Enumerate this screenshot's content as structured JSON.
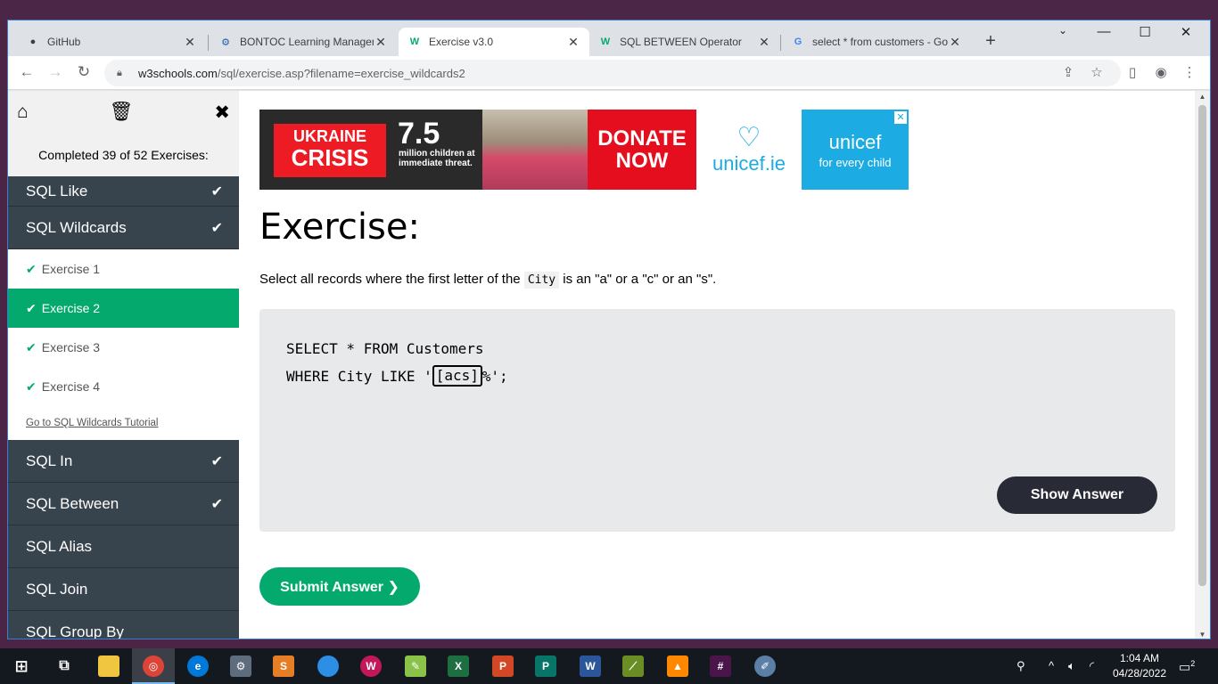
{
  "browser": {
    "tabs": [
      {
        "title": "GitHub",
        "icon": "github-icon",
        "active": false
      },
      {
        "title": "BONTOC Learning Managem",
        "icon": "moodle-icon",
        "active": false
      },
      {
        "title": "Exercise v3.0",
        "icon": "w3schools-icon",
        "active": true
      },
      {
        "title": "SQL BETWEEN Operator",
        "icon": "w3schools-icon",
        "active": false
      },
      {
        "title": "select * from customers - Go",
        "icon": "google-icon",
        "active": false
      }
    ],
    "url_domain": "w3schools.com",
    "url_path": "/sql/exercise.asp?filename=exercise_wildcards2"
  },
  "sidebar": {
    "progress": "Completed 39 of 52 Exercises:",
    "chapters_before": [
      {
        "label": "SQL Like",
        "done": true
      },
      {
        "label": "SQL Wildcards",
        "done": true
      }
    ],
    "exercises": [
      {
        "label": "Exercise 1",
        "active": false
      },
      {
        "label": "Exercise 2",
        "active": true
      },
      {
        "label": "Exercise 3",
        "active": false
      },
      {
        "label": "Exercise 4",
        "active": false
      }
    ],
    "tutorial_link": "Go to SQL Wildcards Tutorial",
    "chapters_after": [
      {
        "label": "SQL In",
        "done": true
      },
      {
        "label": "SQL Between",
        "done": true
      },
      {
        "label": "SQL Alias",
        "done": false
      },
      {
        "label": "SQL Join",
        "done": false
      },
      {
        "label": "SQL Group By",
        "done": false
      }
    ]
  },
  "ad": {
    "ukraine_l1": "UKRAINE",
    "ukraine_l2": "CRISIS",
    "number": "7.5",
    "sub": "million children at immediate threat.",
    "donate_l1": "DONATE",
    "donate_l2": "NOW",
    "unicef_ie": "unicef.ie",
    "unicef": "unicef",
    "unicef_tag": "for every child"
  },
  "exercise": {
    "title": "Exercise:",
    "instr_before": "Select all records where the first letter of the ",
    "instr_code": "City",
    "instr_after": " is an \"a\" or a \"c\" or an \"s\".",
    "code_line1": "SELECT * FROM Customers",
    "code_line2_pre": "WHERE City LIKE '",
    "answer_value": "[acs]",
    "code_line2_post": "%';",
    "show_answer": "Show Answer",
    "submit": "Submit Answer ❯"
  },
  "taskbar": {
    "time": "1:04 AM",
    "date": "04/28/2022",
    "notifications": "2"
  },
  "colors": {
    "accent": "#04aa6d",
    "sidebar_dark": "#38444d",
    "code_bg": "#e7e9eb"
  }
}
